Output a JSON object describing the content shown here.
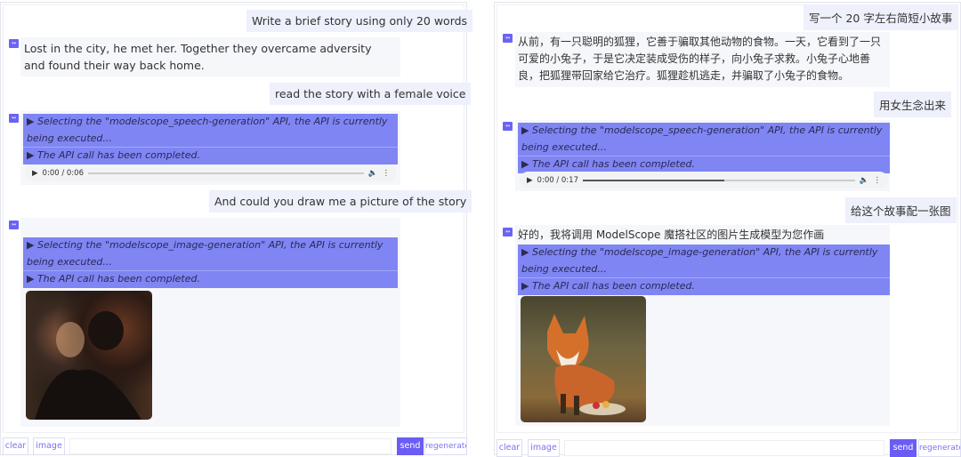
{
  "left": {
    "messages": [
      {
        "role": "user",
        "text": "Write a brief story using only 20 words"
      },
      {
        "role": "bot",
        "text": "Lost in the city, he met her. Together they overcame adversity and found their way back home."
      },
      {
        "role": "user",
        "text": "read the story with a female voice"
      },
      {
        "role": "bot",
        "api": [
          "▶ Selecting the \"modelscope_speech-generation\" API, the API is currently being executed...",
          "▶ The API call has been completed."
        ],
        "audio": {
          "time": "0:00 / 0:06",
          "progress": 0
        }
      },
      {
        "role": "user",
        "text": "And could you draw me a picture of the story"
      },
      {
        "role": "bot",
        "api": [
          "▶ Selecting the \"modelscope_image-generation\" API, the API is currently being executed...",
          "▶ The API call has been completed."
        ],
        "image": "couple-embracing-city-night"
      }
    ],
    "buttons": {
      "clear": "clear",
      "image": "image",
      "send": "send",
      "regenerate": "regenerate"
    }
  },
  "right": {
    "messages": [
      {
        "role": "user",
        "text": "写一个 20 字左右简短小故事"
      },
      {
        "role": "bot",
        "text": "从前，有一只聪明的狐狸，它善于骗取其他动物的食物。一天，它看到了一只可爱的小兔子，于是它决定装成受伤的样子，向小兔子求救。小兔子心地善良，把狐狸带回家给它治疗。狐狸趁机逃走，并骗取了小兔子的食物。"
      },
      {
        "role": "user",
        "text": "用女生念出来"
      },
      {
        "role": "bot",
        "api": [
          "▶ Selecting the \"modelscope_speech-generation\" API, the API is currently being executed...",
          "▶ The API call has been completed."
        ],
        "audio": {
          "time": "0:00 / 0:17",
          "progress": 0.52
        }
      },
      {
        "role": "user",
        "text": "给这个故事配一张图"
      },
      {
        "role": "bot",
        "text": "好的，我将调用 ModelScope 魔搭社区的图片生成模型为您作画",
        "api": [
          "▶ Selecting the \"modelscope_image-generation\" API, the API is currently being executed...",
          "▶ The API call has been completed."
        ],
        "image": "fox-in-forest"
      }
    ],
    "buttons": {
      "clear": "clear",
      "image": "image",
      "send": "send",
      "regenerate": "regenerate"
    }
  },
  "colors": {
    "accent": "#6b5cf5",
    "api_bg": "#7f85f3",
    "user_bubble": "#eef1fb"
  }
}
